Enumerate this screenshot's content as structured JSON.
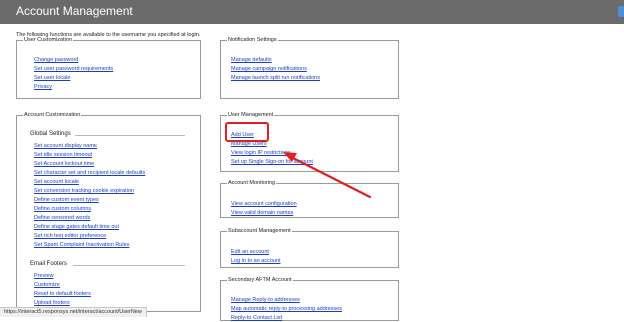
{
  "header": {
    "title": "Account Management",
    "help_icon": "help-icon"
  },
  "intro": "The following functions are available to the username you specified at login.",
  "user_customization": {
    "legend": "User Customization",
    "links": [
      "Change password",
      "Set user password requirements",
      "Set user locale",
      "Privacy"
    ]
  },
  "notification_settings": {
    "legend": "Notification Settings",
    "links": [
      "Manage defaults",
      "Manage campaign notifications",
      "Manage launch split run notifications"
    ]
  },
  "account_customization": {
    "legend": "Account Customization",
    "global_settings_label": "Global Settings",
    "global_links": [
      "Set account display name",
      "Set idle session timeout",
      "Set Account lockout time",
      "Set character set and recipient locale defaults",
      "Set account locale",
      "Set conversion tracking cookie expiration",
      "Define custom event types",
      "Define custom columns",
      "Define censored words",
      "Define stage gates default time out",
      "Set rich text editor preference",
      "Set Spam Complaint Inactivation Rules"
    ],
    "email_footers_label": "Email Footers",
    "footer_links": [
      "Preview",
      "Customize",
      "Reset to default footers",
      "Upload footers"
    ]
  },
  "user_management": {
    "legend": "User Management",
    "links": [
      "Add User",
      "Manage Users",
      "View login IP restrictions",
      "Set up Single Sign-on for account"
    ]
  },
  "account_monitoring": {
    "legend": "Account Monitoring",
    "links": [
      "View account configuration",
      "View valid domain names"
    ]
  },
  "subaccount_management": {
    "legend": "Subaccount Management",
    "links": [
      "Edit an account",
      "Log in to an account"
    ]
  },
  "secondary_aftm": {
    "legend": "Secondary AFTM Account",
    "links": [
      "Manage Reply-to addresses",
      "Map automatic reply-to processing addresses",
      "Reply-to Contact List"
    ]
  },
  "status_bar": "https://interact5.responsys.net/interact/account/UserNew",
  "annotation": {
    "highlight_color": "#e02020"
  }
}
